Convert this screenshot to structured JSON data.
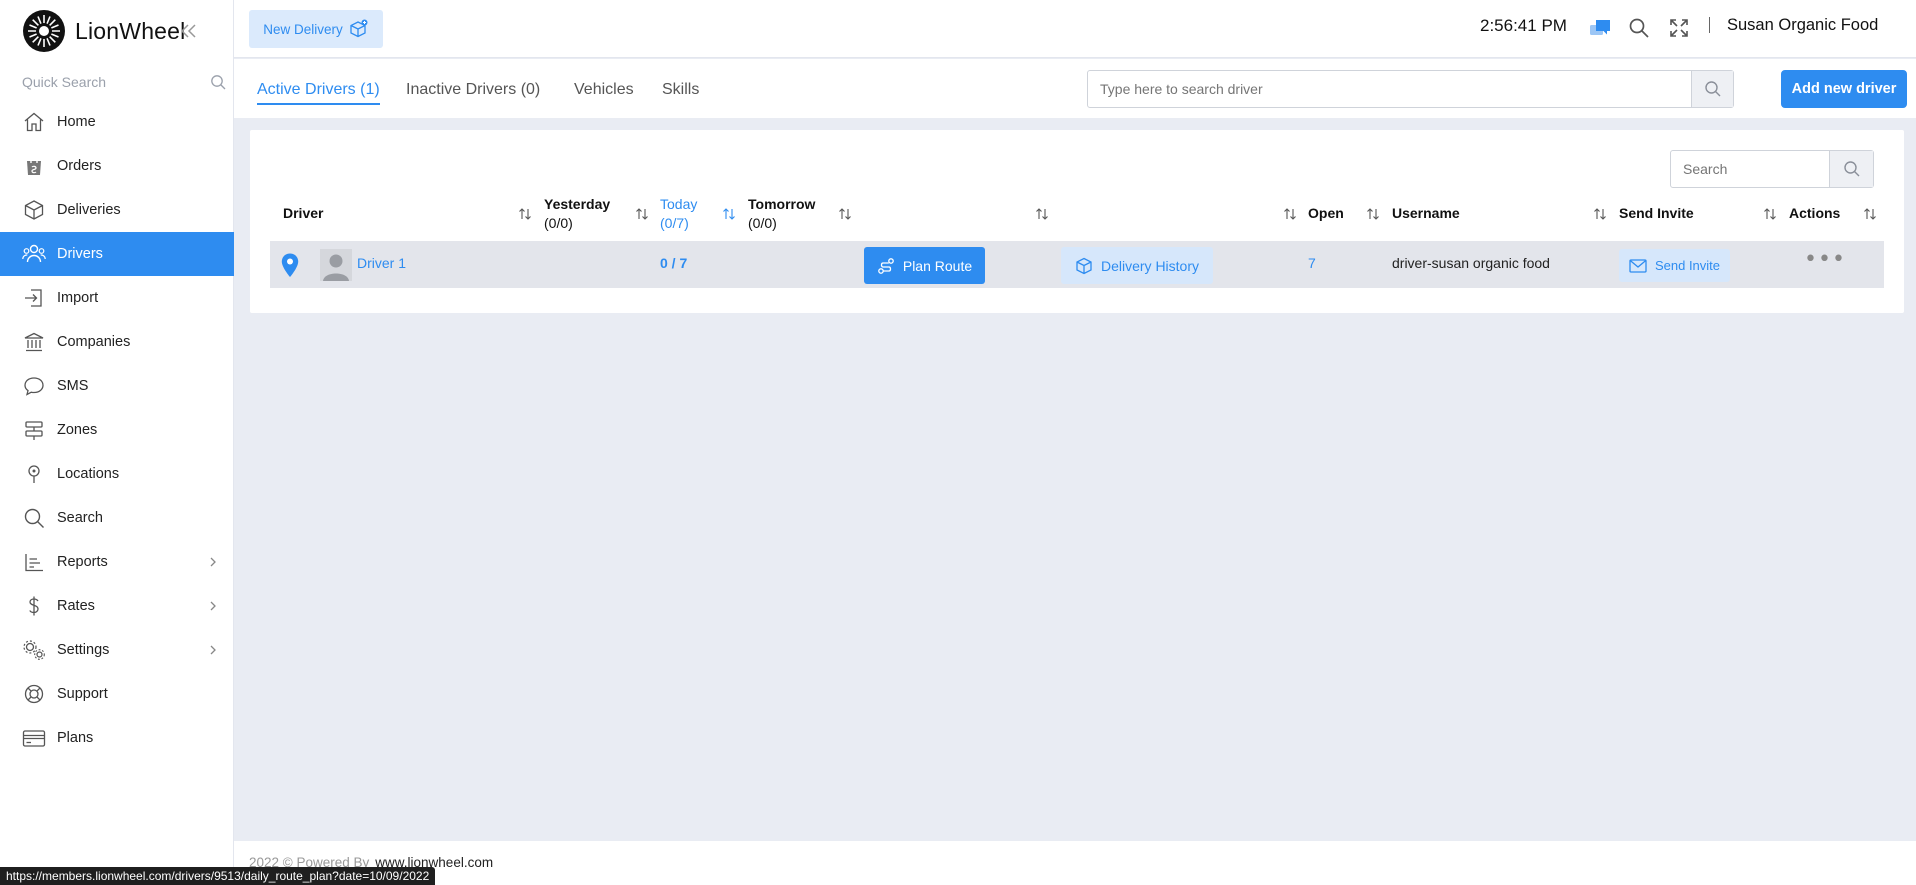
{
  "app": {
    "name": "LionWheel"
  },
  "sidebar": {
    "quick_search_placeholder": "Quick Search",
    "items": [
      {
        "label": "Home",
        "icon": "home-icon"
      },
      {
        "label": "Orders",
        "icon": "shopping-bag-icon"
      },
      {
        "label": "Deliveries",
        "icon": "box-icon"
      },
      {
        "label": "Drivers",
        "icon": "users-icon",
        "active": true
      },
      {
        "label": "Import",
        "icon": "import-icon"
      },
      {
        "label": "Companies",
        "icon": "bank-icon"
      },
      {
        "label": "SMS",
        "icon": "chat-icon"
      },
      {
        "label": "Zones",
        "icon": "zones-icon"
      },
      {
        "label": "Locations",
        "icon": "location-pin-icon"
      },
      {
        "label": "Search",
        "icon": "search-icon"
      },
      {
        "label": "Reports",
        "icon": "bar-chart-icon",
        "submenu": true
      },
      {
        "label": "Rates",
        "icon": "dollar-icon",
        "submenu": true
      },
      {
        "label": "Settings",
        "icon": "gears-icon",
        "submenu": true
      },
      {
        "label": "Support",
        "icon": "lifebuoy-icon"
      },
      {
        "label": "Plans",
        "icon": "credit-card-icon"
      }
    ]
  },
  "topbar": {
    "new_delivery": "New Delivery",
    "time": "2:56:41 PM",
    "user": "Susan Organic Food"
  },
  "tabs": [
    {
      "label": "Active Drivers (1)",
      "active": true
    },
    {
      "label": "Inactive Drivers (0)"
    },
    {
      "label": "Vehicles"
    },
    {
      "label": "Skills"
    }
  ],
  "driver_search": {
    "placeholder": "Type here to search driver"
  },
  "add_driver": "Add new driver",
  "table": {
    "search_placeholder": "Search",
    "headers": {
      "driver": "Driver",
      "yesterday": "Yesterday",
      "yesterday_count": "(0/0)",
      "today": "Today",
      "today_count": "(0/7)",
      "tomorrow": "Tomorrow",
      "tomorrow_count": "(0/0)",
      "open": "Open",
      "username": "Username",
      "send_invite": "Send Invite",
      "actions": "Actions"
    },
    "rows": [
      {
        "driver": "Driver 1",
        "today": "0 / 7",
        "plan_route": "Plan Route",
        "delivery_history": "Delivery History",
        "open": "7",
        "username": "driver-susan organic food",
        "send_invite": "Send Invite",
        "actions": "•••"
      }
    ]
  },
  "footer": {
    "copyright": "2022 © Powered By",
    "link": "www.lionwheel.com"
  },
  "status_url": "https://members.lionwheel.com/drivers/9513/daily_route_plan?date=10/09/2022",
  "colors": {
    "accent": "#2e8cf0",
    "accent_light": "#d6e7fb",
    "background": "#e9ecf3"
  }
}
